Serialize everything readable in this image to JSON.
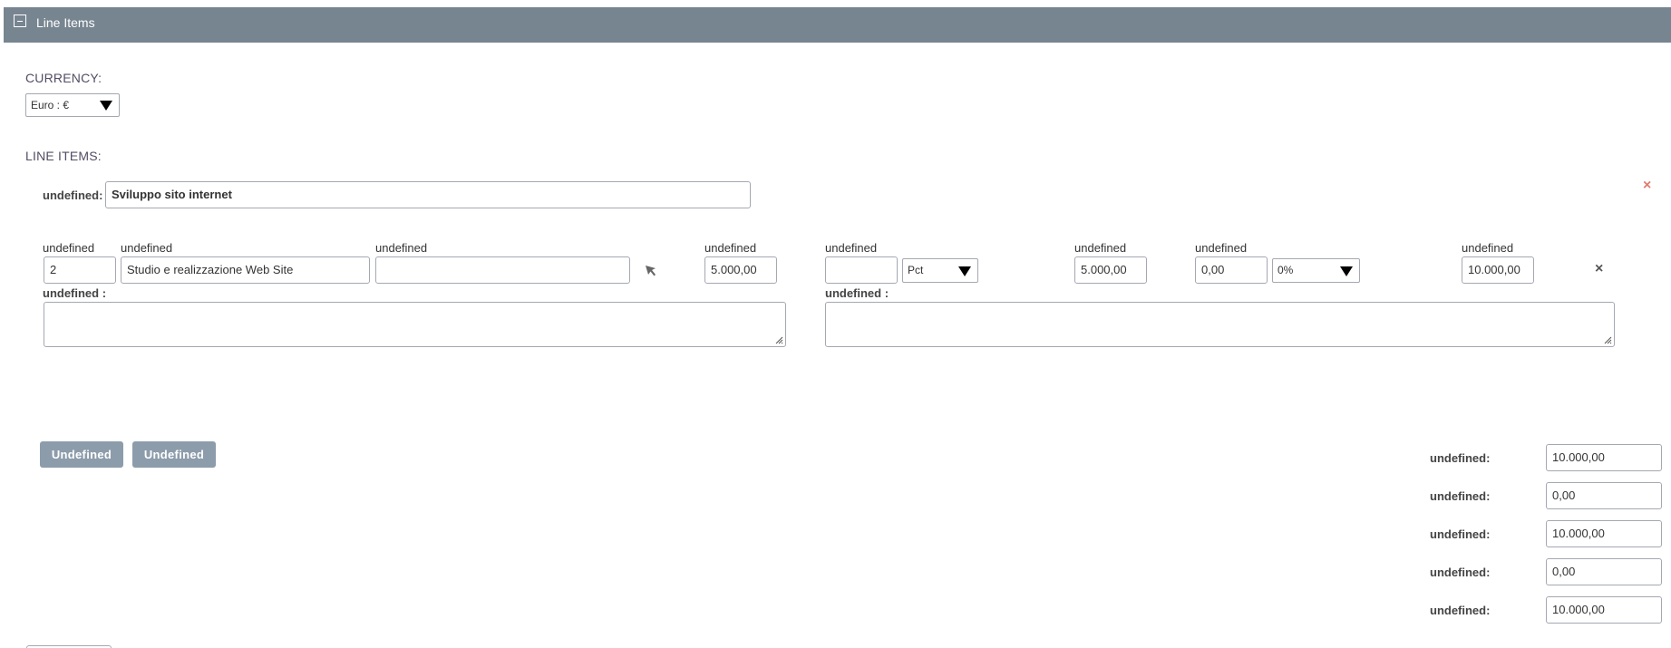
{
  "panel": {
    "title": "Line Items",
    "toggle_symbol": "−"
  },
  "currency": {
    "label": "CURRENCY:",
    "selected": "Euro : €"
  },
  "line_items": {
    "label": "LINE ITEMS:",
    "group": {
      "name_label": "undefined:",
      "name_value": "Sviluppo sito internet",
      "remove_icon": "×"
    },
    "row": {
      "qty": {
        "label": "undefined",
        "value": "2"
      },
      "product": {
        "label": "undefined",
        "value": "Studio e realizzazione Web Site"
      },
      "part": {
        "label": "undefined",
        "value": ""
      },
      "list_price": {
        "label": "undefined",
        "value": "5.000,00"
      },
      "discount": {
        "label": "undefined",
        "value": "",
        "type_selected": "Pct"
      },
      "unit_price": {
        "label": "undefined",
        "value": "5.000,00"
      },
      "tax": {
        "label": "undefined",
        "value": "0,00",
        "rate_selected": "0%"
      },
      "total": {
        "label": "undefined",
        "value": "10.000,00"
      },
      "remove_icon": "×",
      "description_label": "undefined :",
      "note_label": "undefined :"
    },
    "buttons": {
      "add_line": "Undefined",
      "add_group": "Undefined"
    }
  },
  "totals": [
    {
      "label": "undefined:",
      "value": "10.000,00"
    },
    {
      "label": "undefined:",
      "value": "0,00"
    },
    {
      "label": "undefined:",
      "value": "10.000,00"
    },
    {
      "label": "undefined:",
      "value": "0,00"
    },
    {
      "label": "undefined:",
      "value": "10.000,00"
    }
  ],
  "colors": {
    "header_bg": "#778591",
    "button_bg": "#8c9cab",
    "remove_group_icon": "#e07b6f",
    "remove_row_icon": "#555555"
  },
  "icons": {
    "select_product": "cursor-arrow-icon",
    "collapse": "minus-square-icon",
    "remove": "close-icon"
  }
}
